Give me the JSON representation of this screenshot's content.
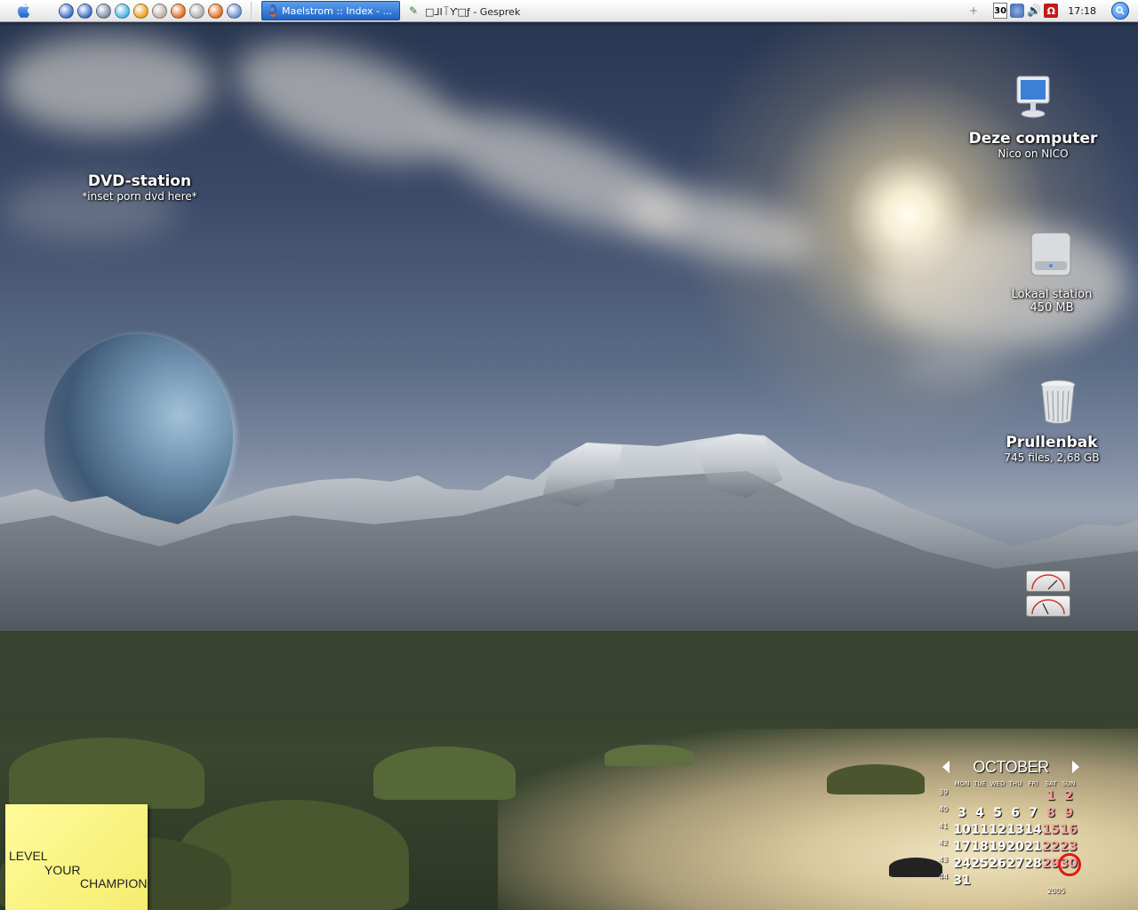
{
  "taskbar": {
    "launchers": [
      {
        "name": "media-player-icon",
        "color": "#3e6fc8"
      },
      {
        "name": "media-player-2-icon",
        "color": "#3e6fc8"
      },
      {
        "name": "monitor-icon",
        "color": "#7a8fa8"
      },
      {
        "name": "qt-icon",
        "color": "#4ab6e8"
      },
      {
        "name": "clock-app-icon",
        "color": "#f0a020"
      },
      {
        "name": "drive-icon",
        "color": "#c0b0a0"
      },
      {
        "name": "firefox-icon",
        "color": "#e07020"
      },
      {
        "name": "drive-2-icon",
        "color": "#b0b0b0"
      },
      {
        "name": "firefox-2-icon",
        "color": "#e07020"
      },
      {
        "name": "network-icon",
        "color": "#6a8fd0"
      }
    ],
    "tasks": [
      {
        "label": "Maelstrom :: Index - ...",
        "active": true
      },
      {
        "label": "□⅃Ι꓄Ƴ□ƒ - Gesprek",
        "active": false
      }
    ],
    "tray": {
      "calendar_badge": "30",
      "clock": "17:18"
    }
  },
  "desktop": {
    "dvd": {
      "title": "DVD-station",
      "subtitle": "*inset porn dvd here*"
    },
    "computer": {
      "title": "Deze computer",
      "subtitle": "Nico on NICO"
    },
    "local_drive": {
      "title": "Lokaal station",
      "subtitle": "450 MB"
    },
    "trash": {
      "title": "Prullenbak",
      "subtitle": "745 files, 2,68 GB"
    }
  },
  "sticky": {
    "line1": "LEVEL",
    "line2": "YOUR",
    "line3": "CHAMPION"
  },
  "calendar": {
    "month": "OCTOBER",
    "year": "2005",
    "dows": [
      "MON",
      "TUE",
      "WED",
      "THU",
      "FRI",
      "SAT",
      "SUN"
    ],
    "weeks": [
      {
        "wk": "39",
        "days": [
          "",
          "",
          "",
          "",
          "",
          "1",
          "2"
        ]
      },
      {
        "wk": "40",
        "days": [
          "3",
          "4",
          "5",
          "6",
          "7",
          "8",
          "9"
        ]
      },
      {
        "wk": "41",
        "days": [
          "10",
          "11",
          "12",
          "13",
          "14",
          "15",
          "16"
        ]
      },
      {
        "wk": "42",
        "days": [
          "17",
          "18",
          "19",
          "20",
          "21",
          "22",
          "23"
        ]
      },
      {
        "wk": "43",
        "days": [
          "24",
          "25",
          "26",
          "27",
          "28",
          "29",
          "30"
        ]
      },
      {
        "wk": "44",
        "days": [
          "31",
          "",
          "",
          "",
          "",
          "",
          ""
        ]
      }
    ],
    "today": "30"
  },
  "colors": {
    "accent": "#1f62c9",
    "today_ring": "#e01818"
  }
}
